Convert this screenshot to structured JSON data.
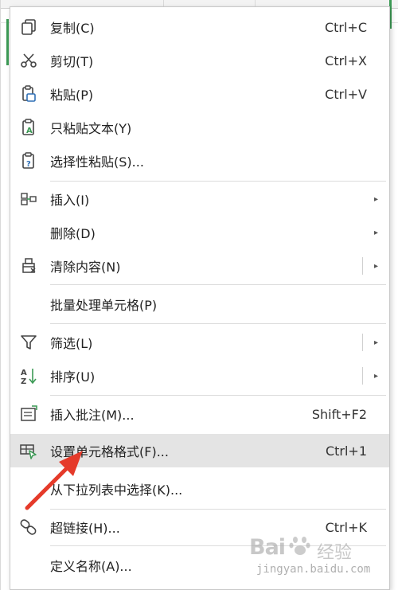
{
  "menu": {
    "items": [
      {
        "label": "复制(C)",
        "shortcut": "Ctrl+C"
      },
      {
        "label": "剪切(T)",
        "shortcut": "Ctrl+X"
      },
      {
        "label": "粘贴(P)",
        "shortcut": "Ctrl+V"
      },
      {
        "label": "只粘贴文本(Y)",
        "shortcut": ""
      },
      {
        "label": "选择性粘贴(S)...",
        "shortcut": ""
      },
      {
        "label": "插入(I)",
        "shortcut": ""
      },
      {
        "label": "删除(D)",
        "shortcut": ""
      },
      {
        "label": "清除内容(N)",
        "shortcut": ""
      },
      {
        "label": "批量处理单元格(P)",
        "shortcut": ""
      },
      {
        "label": "筛选(L)",
        "shortcut": ""
      },
      {
        "label": "排序(U)",
        "shortcut": ""
      },
      {
        "label": "插入批注(M)...",
        "shortcut": "Shift+F2"
      },
      {
        "label": "设置单元格格式(F)...",
        "shortcut": "Ctrl+1"
      },
      {
        "label": "从下拉列表中选择(K)...",
        "shortcut": ""
      },
      {
        "label": "超链接(H)...",
        "shortcut": "Ctrl+K"
      },
      {
        "label": "定义名称(A)...",
        "shortcut": ""
      }
    ],
    "submenu_arrow": "▸",
    "highlighted_index": 12
  },
  "watermark": {
    "brand_left": "Bai",
    "brand_right": "经验",
    "url": "jingyan.baidu.com"
  },
  "colors": {
    "highlight": "#e4e4e4",
    "arrow": "#e53a2a",
    "icon_green": "#3c9a55",
    "icon_blue": "#2f6fb5"
  }
}
